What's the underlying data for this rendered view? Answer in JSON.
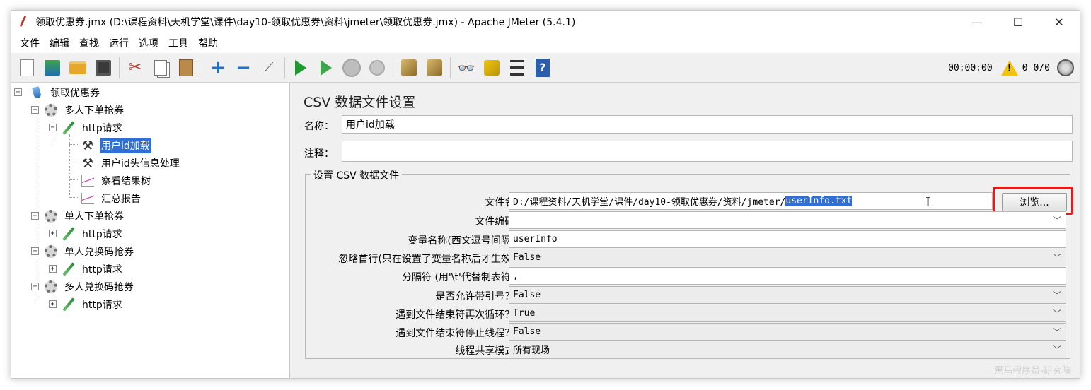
{
  "window": {
    "title": "领取优惠券.jmx (D:\\课程资料\\天机学堂\\课件\\day10-领取优惠券\\资料\\jmeter\\领取优惠券.jmx) - Apache JMeter (5.4.1)",
    "minimize": "—",
    "maximize": "☐",
    "close": "✕"
  },
  "menu": [
    "文件",
    "编辑",
    "查找",
    "运行",
    "选项",
    "工具",
    "帮助"
  ],
  "toolbar": {
    "timer": "00:00:00",
    "warning_count": "0",
    "threads": "0/0",
    "icons": [
      "new-icon",
      "templates-icon",
      "open-icon",
      "save-icon",
      "cut-icon",
      "copy-icon",
      "paste-icon",
      "expand-icon",
      "collapse-icon",
      "toggle-icon",
      "start-icon",
      "start-no-pause-icon",
      "stop-icon",
      "shutdown-icon",
      "clear-icon",
      "clear-all-icon",
      "search-icon",
      "reset-search-icon",
      "function-helper-icon",
      "help-icon"
    ]
  },
  "tree": {
    "nodes": [
      {
        "label": "领取优惠券",
        "icon": "test-plan-icon",
        "level": 0,
        "toggle": "−"
      },
      {
        "label": "多人下单抢券",
        "icon": "thread-group-icon",
        "level": 1,
        "toggle": "−"
      },
      {
        "label": "http请求",
        "icon": "sampler-icon",
        "level": 2,
        "toggle": "−"
      },
      {
        "label": "用户id加载",
        "icon": "config-element-icon",
        "level": 3,
        "toggle": "",
        "selected": true
      },
      {
        "label": "用户id头信息处理",
        "icon": "config-element-icon",
        "level": 3,
        "toggle": ""
      },
      {
        "label": "察看结果树",
        "icon": "listener-icon",
        "level": 3,
        "toggle": ""
      },
      {
        "label": "汇总报告",
        "icon": "listener-icon",
        "level": 3,
        "toggle": ""
      },
      {
        "label": "单人下单抢券",
        "icon": "thread-group-icon",
        "level": 1,
        "toggle": "−"
      },
      {
        "label": "http请求",
        "icon": "sampler-icon",
        "level": 2,
        "toggle": "+"
      },
      {
        "label": "单人兑换码抢券",
        "icon": "thread-group-icon",
        "level": 1,
        "toggle": "−"
      },
      {
        "label": "http请求",
        "icon": "sampler-icon",
        "level": 2,
        "toggle": "+"
      },
      {
        "label": "多人兑换码抢券",
        "icon": "thread-group-icon",
        "level": 1,
        "toggle": "−"
      },
      {
        "label": "http请求",
        "icon": "sampler-icon",
        "level": 2,
        "toggle": "+"
      }
    ]
  },
  "panel": {
    "title": "CSV 数据文件设置",
    "name_label": "名称：",
    "name_value": "用户id加载",
    "comment_label": "注释：",
    "comment_value": "",
    "group_title": "设置 CSV 数据文件",
    "filename_label": "文件名:",
    "filename_prefix": "D:/课程资料/天机学堂/课件/day10-领取优惠券/资料/jmeter/",
    "filename_selected": "userInfo.txt",
    "browse_label": "浏览...",
    "encoding_label": "文件编码:",
    "encoding_value": "",
    "varnames_label": "变量名称(西文逗号间隔):",
    "varnames_value": "userInfo",
    "ignore_first_label": "忽略首行(只在设置了变量名称后才生效):",
    "ignore_first_value": "False",
    "delimiter_label": "分隔符 (用'\\t'代替制表符):",
    "delimiter_value": ",",
    "quoted_label": "是否允许带引号？:",
    "quoted_value": "False",
    "recycle_label": "遇到文件结束符再次循环？:",
    "recycle_value": "True",
    "stop_thread_label": "遇到文件结束符停止线程？:",
    "stop_thread_value": "False",
    "share_mode_label": "线程共享模式:",
    "share_mode_value": "所有现场",
    "chevron": "﹀"
  },
  "watermark": "黑马程序员-研究院"
}
